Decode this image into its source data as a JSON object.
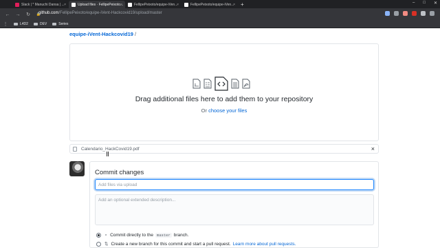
{
  "browser": {
    "tabs": [
      {
        "label": "Slack | * Manuchi Dansa | ...",
        "color": "#e01e5a",
        "active": false
      },
      {
        "label": "Upload files · FellipePeixoto...",
        "color": "#ffffff",
        "active": true
      },
      {
        "label": "FellipePeixoto/equipe-iVen...",
        "color": "#ffffff",
        "active": false
      },
      {
        "label": "FellipePeixoto/equipe-iVen...",
        "color": "#ffffff",
        "active": false
      }
    ],
    "new_tab": "+",
    "url_host": "github.com",
    "url_path": "/FellipePeixoto/equipe-iVent-Hackcovid19/upload/master",
    "bookmarks": [
      "L4D2",
      "DEV",
      "Series"
    ],
    "extension_colors": [
      "#8ab4f8",
      "#9aa0a6",
      "#f28b82",
      "#d93025",
      "#bdc1c6",
      "#9aa0a6"
    ]
  },
  "page": {
    "breadcrumb": "equipe-iVent-Hackcovid19",
    "breadcrumb_sep": "/",
    "dropzone": {
      "title": "Drag additional files here to add them to your repository",
      "or_text": "Or",
      "choose_link": "choose your files"
    },
    "uploaded_file": "Calendario_HackCovid19.pdf",
    "remove_icon": "×",
    "commit": {
      "title": "Commit changes",
      "summary_placeholder": "Add files via upload",
      "summary_value": "",
      "description_placeholder": "Add an optional extended description...",
      "option1_prefix": "Commit directly to the",
      "option1_branch": "master",
      "option1_suffix": "branch.",
      "option2_text": "Create a new branch for this commit and start a pull request.",
      "option2_link": "Learn more about pull requests.",
      "selected_option": 1
    }
  }
}
